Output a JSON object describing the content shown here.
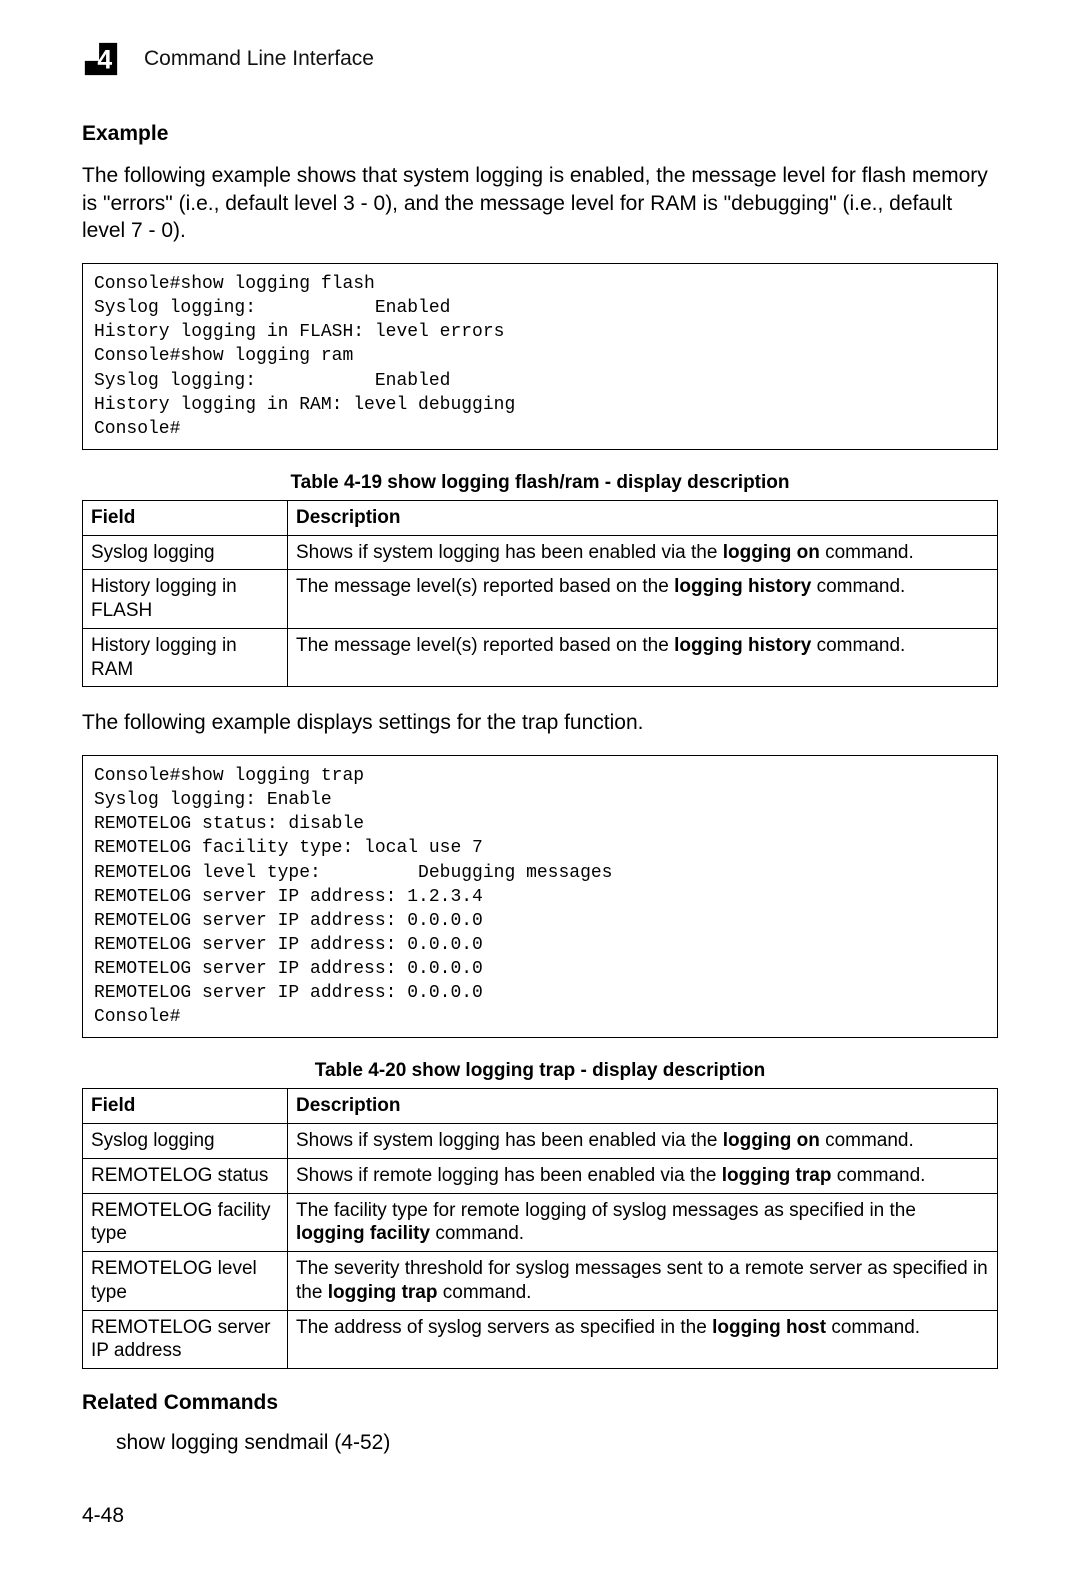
{
  "header": {
    "chapter_number": "4",
    "title": "Command Line Interface"
  },
  "section_example": "Example",
  "intro_paragraph": "The following example shows that system logging is enabled, the message level for flash memory is \"errors\" (i.e., default level 3 - 0), and the message level for RAM is \"debugging\" (i.e., default level 7 - 0).",
  "code_block_1": "Console#show logging flash\nSyslog logging:           Enabled\nHistory logging in FLASH: level errors\nConsole#show logging ram\nSyslog logging:           Enabled\nHistory logging in RAM: level debugging\nConsole#",
  "table1": {
    "caption": "Table 4-19   show logging flash/ram - display description",
    "header_field": "Field",
    "header_desc": "Description",
    "rows": [
      {
        "field": "Syslog logging",
        "desc_pre": "Shows if system logging has been enabled via the ",
        "desc_bold": "logging on",
        "desc_post": " command."
      },
      {
        "field": "History logging in FLASH",
        "desc_pre": "The message level(s) reported based on the ",
        "desc_bold": "logging history",
        "desc_post": " command."
      },
      {
        "field": "History logging in RAM",
        "desc_pre": "The message level(s) reported based on the ",
        "desc_bold": "logging history",
        "desc_post": " command."
      }
    ]
  },
  "mid_paragraph": "The following example displays settings for the trap function.",
  "code_block_2": "Console#show logging trap\nSyslog logging: Enable\nREMOTELOG status: disable\nREMOTELOG facility type: local use 7\nREMOTELOG level type:         Debugging messages\nREMOTELOG server IP address: 1.2.3.4\nREMOTELOG server IP address: 0.0.0.0\nREMOTELOG server IP address: 0.0.0.0\nREMOTELOG server IP address: 0.0.0.0\nREMOTELOG server IP address: 0.0.0.0\nConsole#",
  "table2": {
    "caption": "Table 4-20   show logging trap - display description",
    "header_field": "Field",
    "header_desc": "Description",
    "rows": [
      {
        "field": "Syslog logging",
        "desc_pre": "Shows if system logging has been enabled via the ",
        "desc_bold": "logging on",
        "desc_post": " command."
      },
      {
        "field": "REMOTELOG status",
        "desc_pre": "Shows if remote logging has been enabled via the ",
        "desc_bold": "logging trap",
        "desc_post": " command."
      },
      {
        "field": "REMOTELOG facility type",
        "desc_pre": "The facility type for remote logging of syslog messages as specified in the ",
        "desc_bold": "logging facility",
        "desc_post": " command."
      },
      {
        "field": "REMOTELOG level type",
        "desc_pre": "The severity threshold for syslog messages sent to a remote server as specified in the ",
        "desc_bold": "logging trap",
        "desc_post": " command."
      },
      {
        "field": "REMOTELOG server IP address",
        "desc_pre": "The address of syslog servers as specified in the ",
        "desc_bold": "logging host",
        "desc_post": " command."
      }
    ]
  },
  "related_heading": "Related Commands",
  "related_item": "show logging sendmail (4-52)",
  "page_number": "4-48"
}
